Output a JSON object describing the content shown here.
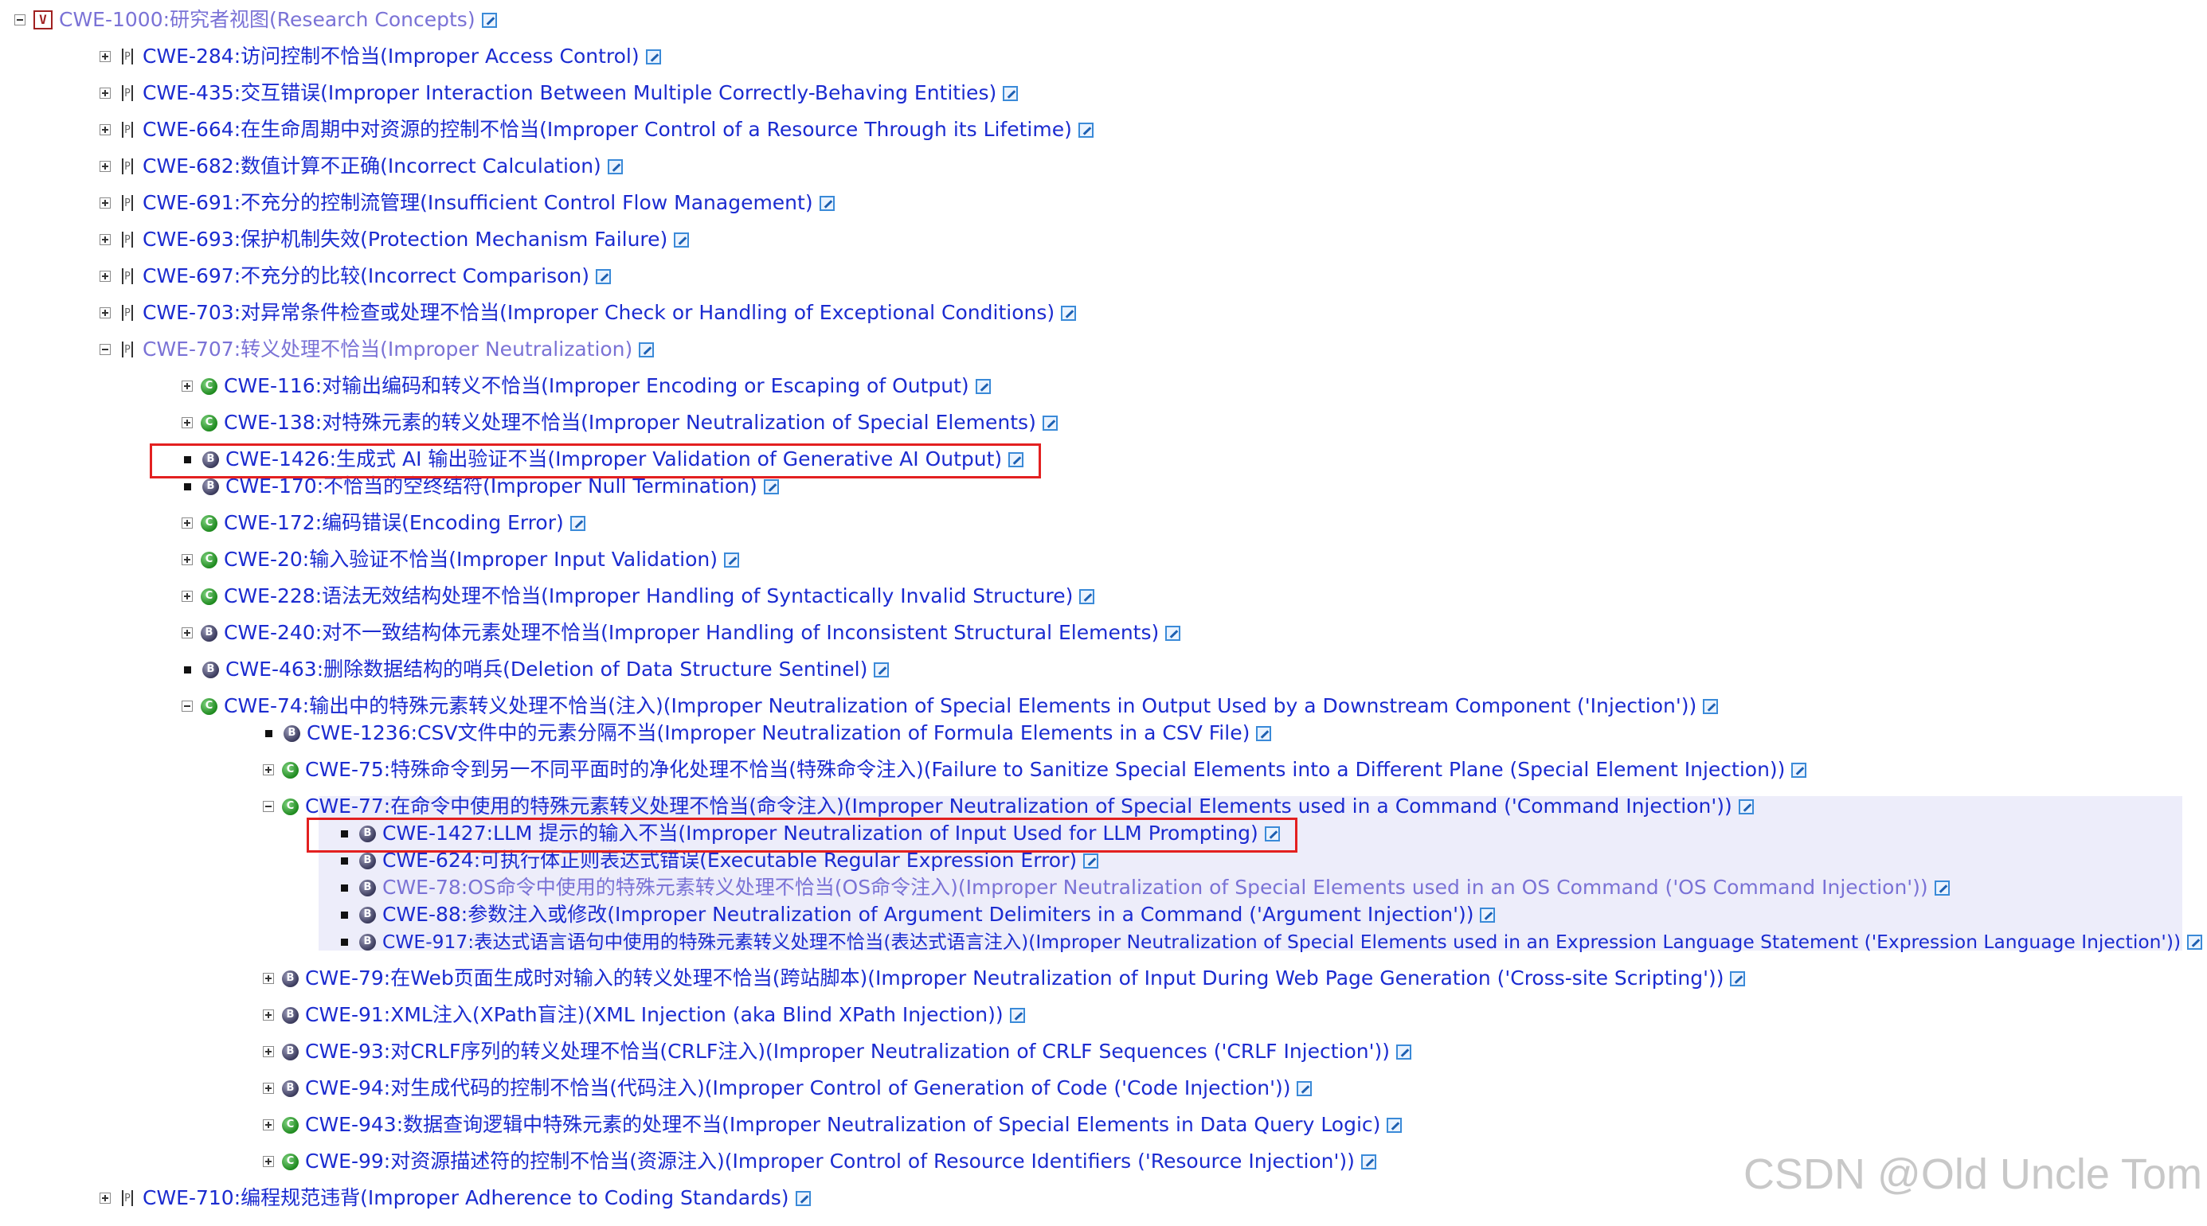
{
  "tree": [
    {
      "id": "n0",
      "depth": 0,
      "toggle": "minus",
      "badge": "view",
      "dim": true,
      "label": "CWE-1000:研究者视图(Research Concepts)"
    },
    {
      "id": "n1",
      "depth": 1,
      "toggle": "plus",
      "badge": "pillar",
      "label": "CWE-284:访问控制不恰当(Improper Access Control)"
    },
    {
      "id": "n2",
      "depth": 1,
      "toggle": "plus",
      "badge": "pillar",
      "label": "CWE-435:交互错误(Improper Interaction Between Multiple Correctly-Behaving Entities)"
    },
    {
      "id": "n3",
      "depth": 1,
      "toggle": "plus",
      "badge": "pillar",
      "label": "CWE-664:在生命周期中对资源的控制不恰当(Improper Control of a Resource Through its Lifetime)"
    },
    {
      "id": "n4",
      "depth": 1,
      "toggle": "plus",
      "badge": "pillar",
      "label": "CWE-682:数值计算不正确(Incorrect Calculation)"
    },
    {
      "id": "n5",
      "depth": 1,
      "toggle": "plus",
      "badge": "pillar",
      "label": "CWE-691:不充分的控制流管理(Insufficient Control Flow Management)"
    },
    {
      "id": "n6",
      "depth": 1,
      "toggle": "plus",
      "badge": "pillar",
      "label": "CWE-693:保护机制失效(Protection Mechanism Failure)"
    },
    {
      "id": "n7",
      "depth": 1,
      "toggle": "plus",
      "badge": "pillar",
      "label": "CWE-697:不充分的比较(Incorrect Comparison)"
    },
    {
      "id": "n8",
      "depth": 1,
      "toggle": "plus",
      "badge": "pillar",
      "label": "CWE-703:对异常条件检查或处理不恰当(Improper Check or Handling of Exceptional Conditions)"
    },
    {
      "id": "n9",
      "depth": 1,
      "toggle": "minus",
      "badge": "pillar",
      "dim": true,
      "label": "CWE-707:转义处理不恰当(Improper Neutralization)"
    },
    {
      "id": "n10",
      "depth": 2,
      "toggle": "plus",
      "badge": "class",
      "label": "CWE-116:对输出编码和转义不恰当(Improper Encoding or Escaping of Output)"
    },
    {
      "id": "n11",
      "depth": 2,
      "toggle": "plus",
      "badge": "class",
      "label": "CWE-138:对特殊元素的转义处理不恰当(Improper Neutralization of Special Elements)"
    },
    {
      "id": "n12",
      "depth": 2,
      "toggle": "bullet",
      "badge": "base",
      "label": "CWE-1426:生成式 AI 输出验证不当(Improper Validation of Generative AI Output)"
    },
    {
      "id": "n13",
      "depth": 2,
      "toggle": "bullet",
      "badge": "base",
      "label": "CWE-170:不恰当的空终结符(Improper Null Termination)"
    },
    {
      "id": "n14",
      "depth": 2,
      "toggle": "plus",
      "badge": "class",
      "label": "CWE-172:编码错误(Encoding Error)"
    },
    {
      "id": "n15",
      "depth": 2,
      "toggle": "plus",
      "badge": "class",
      "label": "CWE-20:输入验证不恰当(Improper Input Validation)"
    },
    {
      "id": "n16",
      "depth": 2,
      "toggle": "plus",
      "badge": "class",
      "label": "CWE-228:语法无效结构处理不恰当(Improper Handling of Syntactically Invalid Structure)"
    },
    {
      "id": "n17",
      "depth": 2,
      "toggle": "plus",
      "badge": "base",
      "label": "CWE-240:对不一致结构体元素处理不恰当(Improper Handling of Inconsistent Structural Elements)"
    },
    {
      "id": "n18",
      "depth": 2,
      "toggle": "bullet",
      "badge": "base",
      "label": "CWE-463:删除数据结构的哨兵(Deletion of Data Structure Sentinel)"
    },
    {
      "id": "n19",
      "depth": 2,
      "toggle": "minus",
      "badge": "class",
      "label": "CWE-74:输出中的特殊元素转义处理不恰当(注入)(Improper Neutralization of Special Elements in Output Used by a Downstream Component ('Injection'))"
    },
    {
      "id": "n20",
      "depth": 3,
      "toggle": "bullet",
      "badge": "base",
      "label": "CWE-1236:CSV文件中的元素分隔不当(Improper Neutralization of Formula Elements in a CSV File)"
    },
    {
      "id": "n21",
      "depth": 3,
      "toggle": "plus",
      "badge": "class",
      "label": "CWE-75:特殊命令到另一不同平面时的净化处理不恰当(特殊命令注入)(Failure to Sanitize Special Elements into a Different Plane (Special Element Injection))"
    },
    {
      "id": "n22",
      "depth": 3,
      "toggle": "minus",
      "badge": "class",
      "label": "CWE-77:在命令中使用的特殊元素转义处理不恰当(命令注入)(Improper Neutralization of Special Elements used in a Command ('Command Injection'))"
    },
    {
      "id": "n23",
      "depth": 4,
      "toggle": "bullet",
      "badge": "base",
      "label": "CWE-1427:LLM 提示的输入不当(Improper Neutralization of Input Used for LLM Prompting)"
    },
    {
      "id": "n24",
      "depth": 4,
      "toggle": "bullet",
      "badge": "base",
      "label": "CWE-624:可执行体正则表达式错误(Executable Regular Expression Error)"
    },
    {
      "id": "n25",
      "depth": 4,
      "toggle": "bullet",
      "badge": "base",
      "dim": true,
      "label": "CWE-78:OS命令中使用的特殊元素转义处理不恰当(OS命令注入)(Improper Neutralization of Special Elements used in an OS Command ('OS Command Injection'))"
    },
    {
      "id": "n26",
      "depth": 4,
      "toggle": "bullet",
      "badge": "base",
      "label": "CWE-88:参数注入或修改(Improper Neutralization of Argument Delimiters in a Command ('Argument Injection'))"
    },
    {
      "id": "n27",
      "depth": 4,
      "toggle": "bullet",
      "badge": "base",
      "label": "CWE-917:表达式语言语句中使用的特殊元素转义处理不恰当(表达式语言注入)(Improper Neutralization of Special Elements used in an Expression Language Statement ('Expression Language Injection'))"
    },
    {
      "id": "n28",
      "depth": 3,
      "toggle": "plus",
      "badge": "base",
      "label": "CWE-79:在Web页面生成时对输入的转义处理不恰当(跨站脚本)(Improper Neutralization of Input During Web Page Generation ('Cross-site Scripting'))"
    },
    {
      "id": "n29",
      "depth": 3,
      "toggle": "plus",
      "badge": "base",
      "label": "CWE-91:XML注入(XPath盲注)(XML Injection (aka Blind XPath Injection))"
    },
    {
      "id": "n30",
      "depth": 3,
      "toggle": "plus",
      "badge": "base",
      "label": "CWE-93:对CRLF序列的转义处理不恰当(CRLF注入)(Improper Neutralization of CRLF Sequences ('CRLF Injection'))"
    },
    {
      "id": "n31",
      "depth": 3,
      "toggle": "plus",
      "badge": "base",
      "label": "CWE-94:对生成代码的控制不恰当(代码注入)(Improper Control of Generation of Code ('Code Injection'))"
    },
    {
      "id": "n32",
      "depth": 3,
      "toggle": "plus",
      "badge": "class",
      "label": "CWE-943:数据查询逻辑中特殊元素的处理不当(Improper Neutralization of Special Elements in Data Query Logic)"
    },
    {
      "id": "n33",
      "depth": 3,
      "toggle": "plus",
      "badge": "class",
      "label": "CWE-99:对资源描述符的控制不恰当(资源注入)(Improper Control of Resource Identifiers ('Resource Injection'))"
    },
    {
      "id": "n34",
      "depth": 1,
      "toggle": "plus",
      "badge": "pillar",
      "label": "CWE-710:编程规范违背(Improper Adherence to Coding Standards)"
    }
  ],
  "highlights": [
    "n12",
    "n23"
  ],
  "watermark": "CSDN @Old Uncle Tom"
}
